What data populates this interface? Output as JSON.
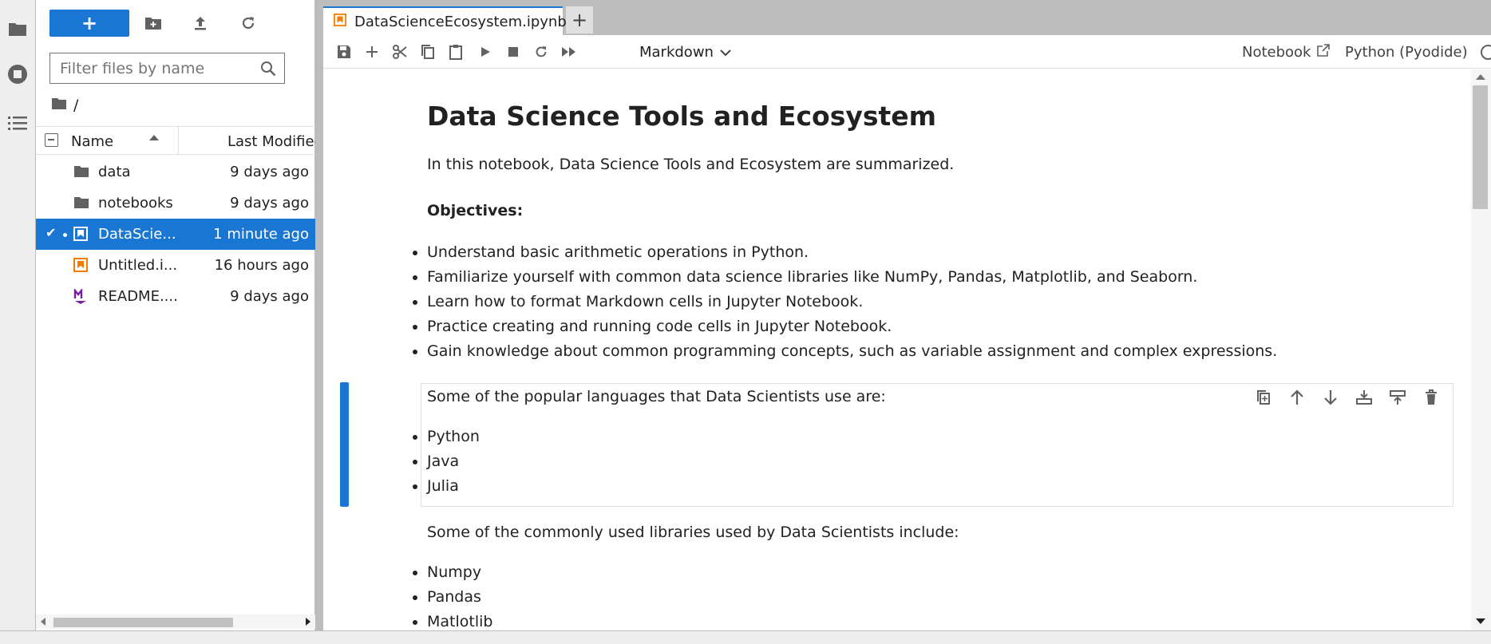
{
  "sidebar": {
    "icons": [
      "folder-icon",
      "stop-icon",
      "list-icon"
    ]
  },
  "file_browser": {
    "new_label": "+",
    "filter": {
      "placeholder": "Filter files by name",
      "value": ""
    },
    "breadcrumb": "/",
    "columns": {
      "name": "Name",
      "modified": "Last Modified"
    },
    "rows": [
      {
        "name": "data",
        "modified": "9 days ago",
        "icon": "folder-icon",
        "selected": false
      },
      {
        "name": "notebooks",
        "modified": "9 days ago",
        "icon": "folder-icon",
        "selected": false
      },
      {
        "name": "DataScie...",
        "modified": "1 minute ago",
        "icon": "notebook-icon",
        "selected": true
      },
      {
        "name": "Untitled.i...",
        "modified": "16 hours ago",
        "icon": "notebook-icon",
        "selected": false
      },
      {
        "name": "README....",
        "modified": "9 days ago",
        "icon": "markdown-icon",
        "selected": false
      }
    ]
  },
  "tab": {
    "title": "DataScienceEcosystem.ipynb",
    "add_label": "+"
  },
  "notebook_toolbar": {
    "cell_type": "Markdown",
    "notebook_label": "Notebook",
    "kernel_label": "Python (Pyodide)"
  },
  "notebook": {
    "title": "Data Science Tools and Ecosystem",
    "intro": "In this notebook, Data Science Tools and Ecosystem are summarized.",
    "objectives_heading": "Objectives:",
    "objectives": [
      "Understand basic arithmetic operations in Python.",
      "Familiarize yourself with common data science libraries like NumPy, Pandas, Matplotlib, and Seaborn.",
      "Learn how to format Markdown cells in Jupyter Notebook.",
      "Practice creating and running code cells in Jupyter Notebook.",
      "Gain knowledge about common programming concepts, such as variable assignment and complex expressions."
    ],
    "languages_intro": "Some of the popular languages that Data Scientists use are:",
    "languages": [
      "Python",
      "Java",
      "Julia"
    ],
    "libraries_intro": "Some of the commonly used libraries used by Data Scientists include:",
    "libraries": [
      "Numpy",
      "Pandas",
      "Matlotlib"
    ]
  },
  "colors": {
    "accent": "#1976d2",
    "notebook_icon": "#f57c00",
    "markdown_icon": "#7b1fa2"
  }
}
